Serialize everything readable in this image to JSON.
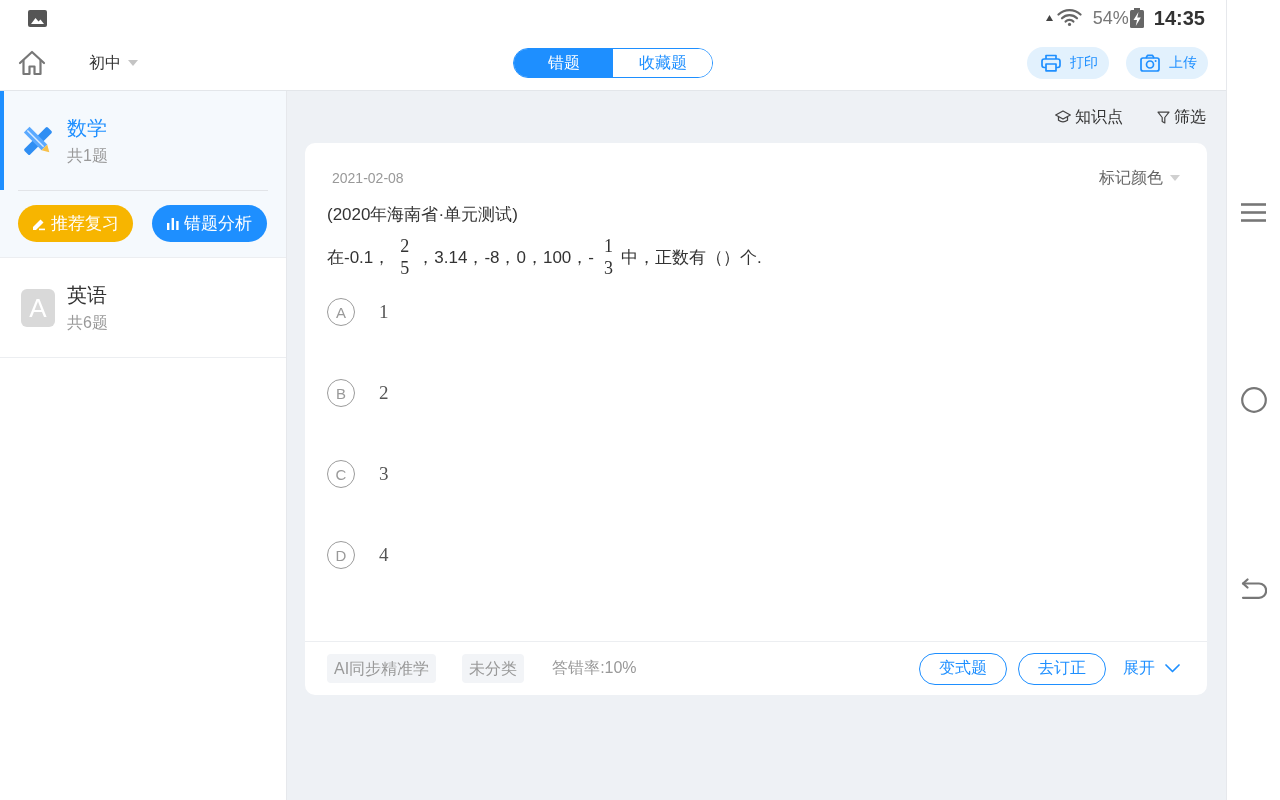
{
  "status_bar": {
    "battery": "54%",
    "time": "14:35"
  },
  "top_bar": {
    "grade": "初中",
    "tabs": [
      {
        "label": "错题",
        "selected": true
      },
      {
        "label": "收藏题",
        "selected": false
      }
    ],
    "actions": [
      {
        "kind": "print",
        "label": "打印"
      },
      {
        "kind": "upload",
        "label": "上传"
      }
    ]
  },
  "sidebar": {
    "subjects": [
      {
        "kind": "math",
        "name": "数学",
        "count": "共1题",
        "selected": true,
        "actions": [
          {
            "kind": "review",
            "label": "推荐复习"
          },
          {
            "kind": "analysis",
            "label": "错题分析"
          }
        ]
      },
      {
        "kind": "english",
        "icon_letter": "A",
        "name": "英语",
        "count": "共6题",
        "selected": false
      }
    ]
  },
  "toolbar": [
    {
      "kind": "knowledge",
      "label": "知识点"
    },
    {
      "kind": "filter",
      "label": "筛选"
    }
  ],
  "question_card": {
    "date": "2021-02-08",
    "mark_color": "标记颜色",
    "source": "(2020年海南省·单元测试)",
    "question": [
      {
        "kind": "text",
        "text": "在-0.1，"
      },
      {
        "kind": "fraction",
        "numerator": "2",
        "denominator": "5"
      },
      {
        "kind": "text",
        "text": "，3.14，-8，0，100，-"
      },
      {
        "kind": "fraction",
        "numerator": "1",
        "denominator": "3"
      },
      {
        "kind": "text",
        "text": "中，正数有（）个."
      }
    ],
    "options": [
      {
        "letter": "A",
        "value": "1"
      },
      {
        "letter": "B",
        "value": "2"
      },
      {
        "letter": "C",
        "value": "3"
      },
      {
        "letter": "D",
        "value": "4"
      }
    ],
    "tags": [
      "AI同步精准学",
      "未分类"
    ],
    "error_rate": "答错率:10%",
    "buttons": [
      "变式题",
      "去订正"
    ],
    "expand": "展开"
  }
}
